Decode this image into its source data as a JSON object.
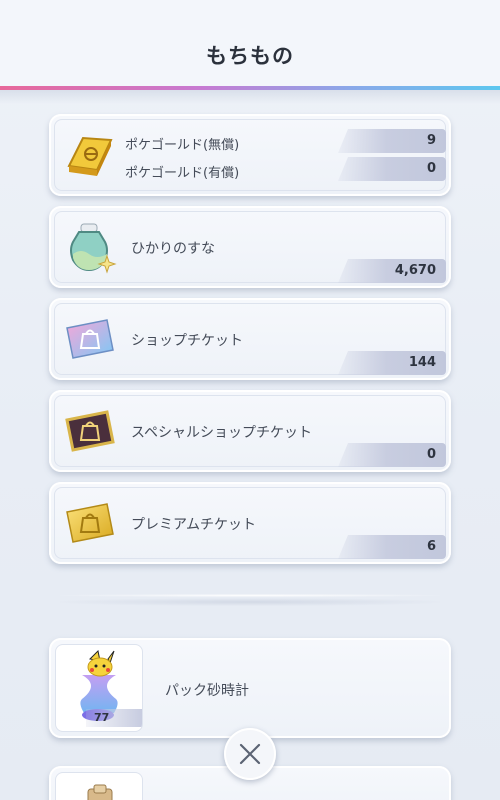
{
  "header": {
    "title": "もちもの"
  },
  "items": [
    {
      "label_free": "ポケゴールド(無償)",
      "value_free": "9",
      "label_paid": "ポケゴールド(有償)",
      "value_paid": "0",
      "icon": "gold-bar-icon"
    },
    {
      "label": "ひかりのすな",
      "value": "4,670",
      "icon": "shining-sand-bottle-icon"
    },
    {
      "label": "ショップチケット",
      "value": "144",
      "icon": "shop-ticket-icon"
    },
    {
      "label": "スペシャルショップチケット",
      "value": "0",
      "icon": "special-shop-ticket-icon"
    },
    {
      "label": "プレミアムチケット",
      "value": "6",
      "icon": "premium-ticket-icon"
    }
  ],
  "pack_hourglass": {
    "label": "パック砂時計",
    "count": "77",
    "icon": "pack-hourglass-icon"
  },
  "colors": {
    "accent_pink": "#e7689a",
    "accent_blue": "#5cc7ef",
    "gold": "#e6b92c"
  }
}
